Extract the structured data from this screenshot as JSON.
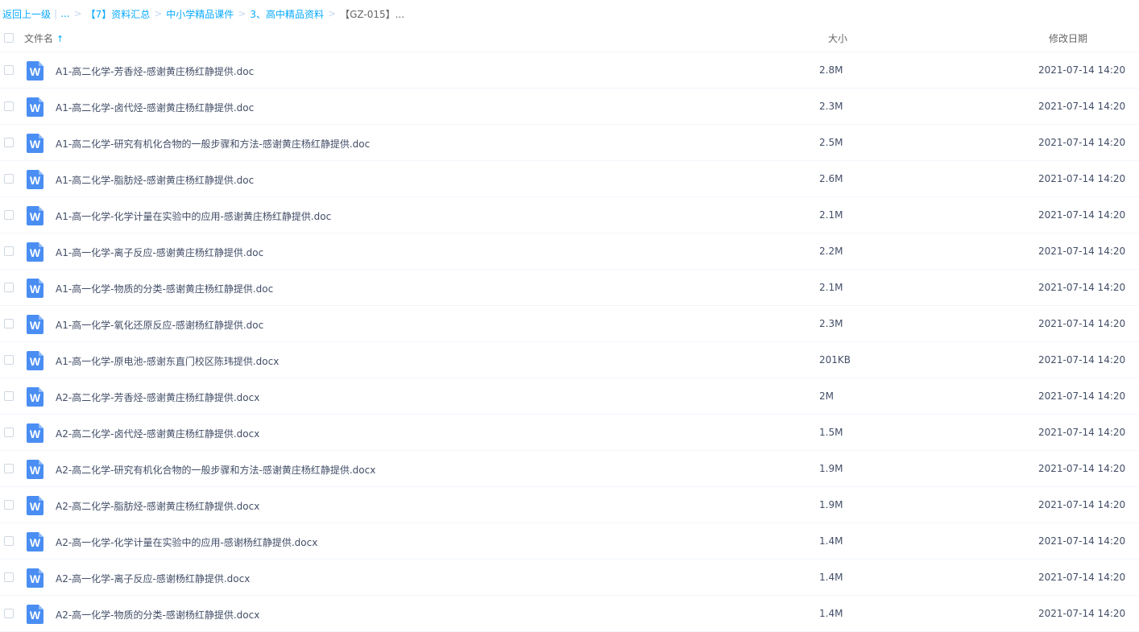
{
  "breadcrumb": {
    "back": "返回上一级",
    "bar": "|",
    "ellipsis": "...",
    "sep": ">",
    "items": [
      "【7】资料汇总",
      "中小学精品课件",
      "3、高中精品资料"
    ],
    "current": "【GZ-015】..."
  },
  "header": {
    "name": "文件名",
    "sort_icon": "arrow-up-icon",
    "size": "大小",
    "date": "修改日期"
  },
  "files": [
    {
      "name": "A1-高二化学-芳香烃-感谢黄庄杨红静提供.doc",
      "size": "2.8M",
      "date": "2021-07-14 14:20"
    },
    {
      "name": "A1-高二化学-卤代烃-感谢黄庄杨红静提供.doc",
      "size": "2.3M",
      "date": "2021-07-14 14:20"
    },
    {
      "name": "A1-高二化学-研究有机化合物的一般步骤和方法-感谢黄庄杨红静提供.doc",
      "size": "2.5M",
      "date": "2021-07-14 14:20"
    },
    {
      "name": "A1-高二化学-脂肪烃-感谢黄庄杨红静提供.doc",
      "size": "2.6M",
      "date": "2021-07-14 14:20"
    },
    {
      "name": "A1-高一化学-化学计量在实验中的应用-感谢黄庄杨红静提供.doc",
      "size": "2.1M",
      "date": "2021-07-14 14:20"
    },
    {
      "name": "A1-高一化学-离子反应-感谢黄庄杨红静提供.doc",
      "size": "2.2M",
      "date": "2021-07-14 14:20"
    },
    {
      "name": "A1-高一化学-物质的分类-感谢黄庄杨红静提供.doc",
      "size": "2.1M",
      "date": "2021-07-14 14:20"
    },
    {
      "name": "A1-高一化学-氧化还原反应-感谢杨红静提供.doc",
      "size": "2.3M",
      "date": "2021-07-14 14:20"
    },
    {
      "name": "A1-高一化学-原电池-感谢东直门校区陈玮提供.docx",
      "size": "201KB",
      "date": "2021-07-14 14:20"
    },
    {
      "name": "A2-高二化学-芳香烃-感谢黄庄杨红静提供.docx",
      "size": "2M",
      "date": "2021-07-14 14:20"
    },
    {
      "name": "A2-高二化学-卤代烃-感谢黄庄杨红静提供.docx",
      "size": "1.5M",
      "date": "2021-07-14 14:20"
    },
    {
      "name": "A2-高二化学-研究有机化合物的一般步骤和方法-感谢黄庄杨红静提供.docx",
      "size": "1.9M",
      "date": "2021-07-14 14:20"
    },
    {
      "name": "A2-高二化学-脂肪烃-感谢黄庄杨红静提供.docx",
      "size": "1.9M",
      "date": "2021-07-14 14:20"
    },
    {
      "name": "A2-高一化学-化学计量在实验中的应用-感谢杨红静提供.docx",
      "size": "1.4M",
      "date": "2021-07-14 14:20"
    },
    {
      "name": "A2-高一化学-离子反应-感谢杨红静提供.docx",
      "size": "1.4M",
      "date": "2021-07-14 14:20"
    },
    {
      "name": "A2-高一化学-物质的分类-感谢杨红静提供.docx",
      "size": "1.4M",
      "date": "2021-07-14 14:20"
    }
  ],
  "file_icon": {
    "name": "word-doc-icon",
    "glyph": "W",
    "color": "#4a8ef3"
  },
  "colors": {
    "link": "#09aaff",
    "text": "#424e67",
    "divider": "#f2f6fd"
  }
}
